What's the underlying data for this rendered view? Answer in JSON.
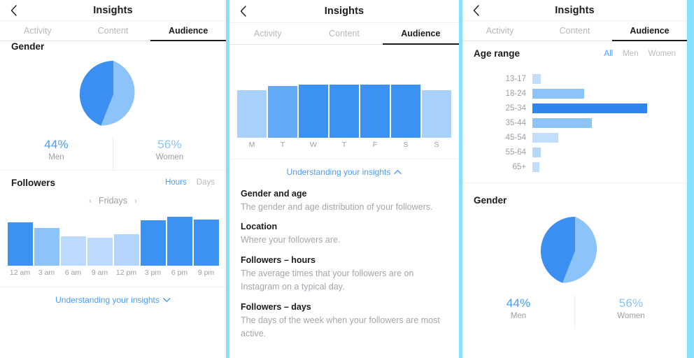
{
  "nav": {
    "title": "Insights",
    "back_icon": "chevron-left-icon"
  },
  "tabs": [
    {
      "label": "Activity",
      "active": false
    },
    {
      "label": "Content",
      "active": false
    },
    {
      "label": "Audience",
      "active": true
    }
  ],
  "screen1": {
    "gender": {
      "title": "Gender",
      "men_pct": "44%",
      "men_label": "Men",
      "women_pct": "56%",
      "women_label": "Women"
    },
    "followers": {
      "title": "Followers",
      "toggle_hours": "Hours",
      "toggle_days": "Days",
      "selected_toggle": "Hours",
      "day_prev_icon": "chevron-left-icon",
      "day_next_icon": "chevron-right-icon",
      "day_label": "Fridays"
    },
    "expander": {
      "label": "Understanding your insights",
      "icon": "chevron-down-icon"
    }
  },
  "screen2": {
    "expander": {
      "label": "Understanding your insights",
      "icon": "chevron-up-icon"
    },
    "glossary": [
      {
        "term": "Gender and age",
        "definition": "The gender and age distribution of your followers."
      },
      {
        "term": "Location",
        "definition": "Where your followers are."
      },
      {
        "term": "Followers – hours",
        "definition": "The average times that your followers are on Instagram on a typical day."
      },
      {
        "term": "Followers – days",
        "definition": "The days of the week when your followers are most active."
      }
    ]
  },
  "screen3": {
    "age": {
      "title": "Age range",
      "filters": [
        {
          "label": "All",
          "active": true
        },
        {
          "label": "Men",
          "active": false
        },
        {
          "label": "Women",
          "active": false
        }
      ]
    },
    "gender": {
      "title": "Gender",
      "men_pct": "44%",
      "men_label": "Men",
      "women_pct": "56%",
      "women_label": "Women"
    }
  },
  "colors": {
    "accent": "#4a9cf6",
    "bar_dark": "#3b92f0",
    "bar_mid": "#6fb2f8",
    "bar_light": "#a8d2fc",
    "bar_lighter": "#c2defd",
    "pie_dark": "#3b8ff0",
    "pie_light": "#8cc3fa",
    "text_primary": "#1b1b1b",
    "text_muted": "#9b9ea3",
    "frame": "#89dfff"
  },
  "chart_data": [
    {
      "id": "gender-pie-screen1",
      "type": "pie",
      "title": "Gender",
      "categories": [
        "Men",
        "Women"
      ],
      "values": [
        44,
        56
      ],
      "value_labels": [
        "44%",
        "56%"
      ],
      "colors": [
        "#3b8ff0",
        "#8cc3fa"
      ],
      "legend": "below"
    },
    {
      "id": "followers-hours-screen1",
      "type": "bar",
      "title": "Followers",
      "subtitle": "Fridays",
      "xlabel": "",
      "ylabel": "",
      "grid": false,
      "categories": [
        "12 am",
        "3 am",
        "6 am",
        "9 am",
        "12 pm",
        "3 pm",
        "6 pm",
        "9 pm"
      ],
      "values": [
        62,
        54,
        42,
        40,
        45,
        65,
        70,
        66
      ],
      "ylim": [
        0,
        72
      ],
      "bar_colors": [
        "#3b92f0",
        "#8cc3fa",
        "#bcdafd",
        "#bcdafd",
        "#b3d5fd",
        "#3b92f0",
        "#3b92f0",
        "#3b92f0"
      ]
    },
    {
      "id": "followers-days-screen2",
      "type": "bar",
      "title": "Followers – days",
      "xlabel": "",
      "ylabel": "",
      "grid": false,
      "categories": [
        "M",
        "T",
        "W",
        "T",
        "F",
        "S",
        "S"
      ],
      "values": [
        68,
        74,
        76,
        76,
        76,
        76,
        68
      ],
      "ylim": [
        0,
        80
      ],
      "bar_colors": [
        "#a8d2fc",
        "#63abf7",
        "#3b92f0",
        "#3b92f0",
        "#3b92f0",
        "#3b92f0",
        "#a8d2fc"
      ]
    },
    {
      "id": "age-range-screen3",
      "type": "bar",
      "orientation": "horizontal",
      "title": "Age range",
      "xlabel": "",
      "ylabel": "",
      "grid": false,
      "categories": [
        "13-17",
        "18-24",
        "25-34",
        "35-44",
        "45-54",
        "55-64",
        "65+"
      ],
      "values": [
        7,
        45,
        100,
        52,
        22,
        7,
        6
      ],
      "xlim": [
        0,
        100
      ],
      "bar_colors": [
        "#c2defd",
        "#8cc3fa",
        "#2f85ed",
        "#8cc3fa",
        "#c2defd",
        "#b7d8fd",
        "#c2defd"
      ],
      "filter": "All"
    },
    {
      "id": "gender-pie-screen3",
      "type": "pie",
      "title": "Gender",
      "categories": [
        "Men",
        "Women"
      ],
      "values": [
        44,
        56
      ],
      "value_labels": [
        "44%",
        "56%"
      ],
      "colors": [
        "#3b8ff0",
        "#8cc3fa"
      ],
      "legend": "below"
    }
  ]
}
